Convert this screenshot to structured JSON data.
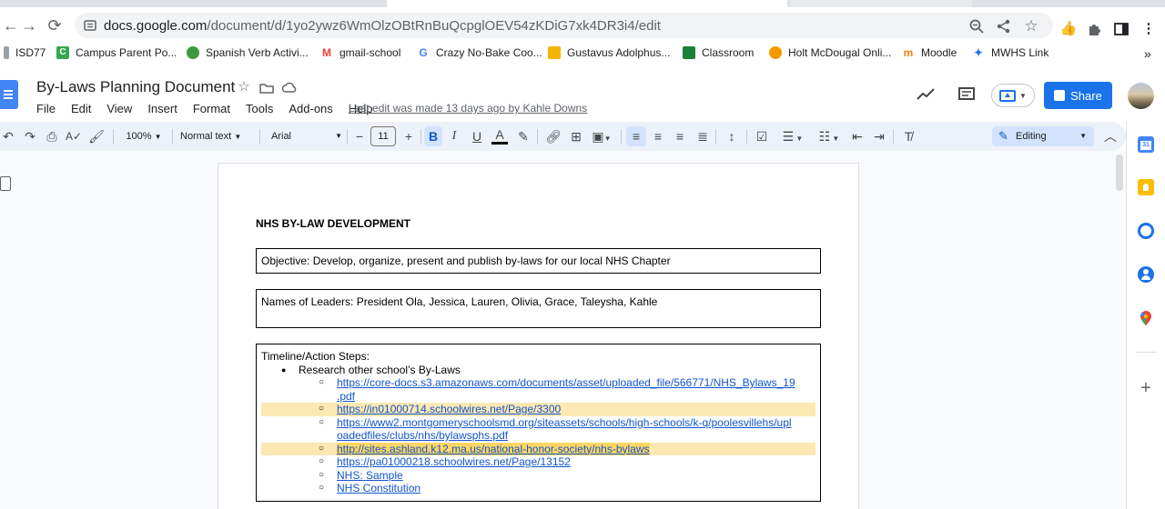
{
  "browser": {
    "url_host": "docs.google.com",
    "url_path": "/document/d/1yo2ywz6WmOlzOBtRnBuQcpglOEV54zKDiG7xk4DR3i4/edit",
    "bookmarks": [
      {
        "label": "ISD77",
        "color": "#9aa0a6"
      },
      {
        "label": "Campus Parent Po...",
        "color": "#34a853"
      },
      {
        "label": "Spanish Verb Activi...",
        "color": "#3c9a3c"
      },
      {
        "label": "gmail-school",
        "color": "#ea4335"
      },
      {
        "label": "Crazy No-Bake Coo...",
        "color": "#4285f4"
      },
      {
        "label": "Gustavus Adolphus...",
        "color": "#f4b400"
      },
      {
        "label": "Classroom",
        "color": "#188038"
      },
      {
        "label": "Holt McDougal Onli...",
        "color": "#f29900"
      },
      {
        "label": "Moodle",
        "color": "#f98012"
      },
      {
        "label": "MWHS Link",
        "color": "#1a73e8"
      }
    ],
    "bookmarks_overflow": "»"
  },
  "docs": {
    "title": "By-Laws Planning Document",
    "menu": [
      "File",
      "Edit",
      "View",
      "Insert",
      "Format",
      "Tools",
      "Add-ons",
      "Help"
    ],
    "last_edit": "Last edit was made 13 days ago by Kahle Downs",
    "share_label": "Share",
    "toolbar": {
      "zoom": "100%",
      "style": "Normal text",
      "font": "Arial",
      "font_size": "11",
      "mode": "Editing"
    }
  },
  "document": {
    "heading": "NHS BY-LAW DEVELOPMENT",
    "objective": "Objective: Develop, organize, present and publish by-laws for our local NHS Chapter",
    "leaders": "Names of Leaders: President Ola, Jessica, Lauren, Olivia, Grace, Taleysha, Kahle",
    "timeline_label": "Timeline/Action Steps:",
    "step1": "Research other school’s By-Laws",
    "links": [
      {
        "line1": "https://core-docs.s3.amazonaws.com/documents/asset/uploaded_file/566771/NHS_Bylaws_19",
        "line2": ".pdf",
        "highlight": "none"
      },
      {
        "line1": "https://in01000714.schoolwires.net/Page/3300",
        "line2": "",
        "highlight": "light"
      },
      {
        "line1": "https://www2.montgomeryschoolsmd.org/siteassets/schools/high-schools/k-q/poolesvillehs/upl",
        "line2": "oadedfiles/clubs/nhs/bylawsphs.pdf",
        "highlight": "none"
      },
      {
        "line1": "http://sites.ashland.k12.ma.us/national-honor-society/nhs-bylaws",
        "line2": "",
        "highlight": "strong"
      },
      {
        "line1": "https://pa01000218.schoolwires.net/Page/13152",
        "line2": "",
        "highlight": "none"
      },
      {
        "line1": "NHS: Sample",
        "line2": "",
        "highlight": "none"
      },
      {
        "line1": "NHS Constitution",
        "line2": "",
        "highlight": "none"
      }
    ]
  },
  "colors": {
    "accent": "#1a73e8",
    "link": "#1155cc",
    "highlight_light": "#fce8b2",
    "highlight_strong": "#fdd663",
    "toolbar_bg": "#edf2fa"
  }
}
